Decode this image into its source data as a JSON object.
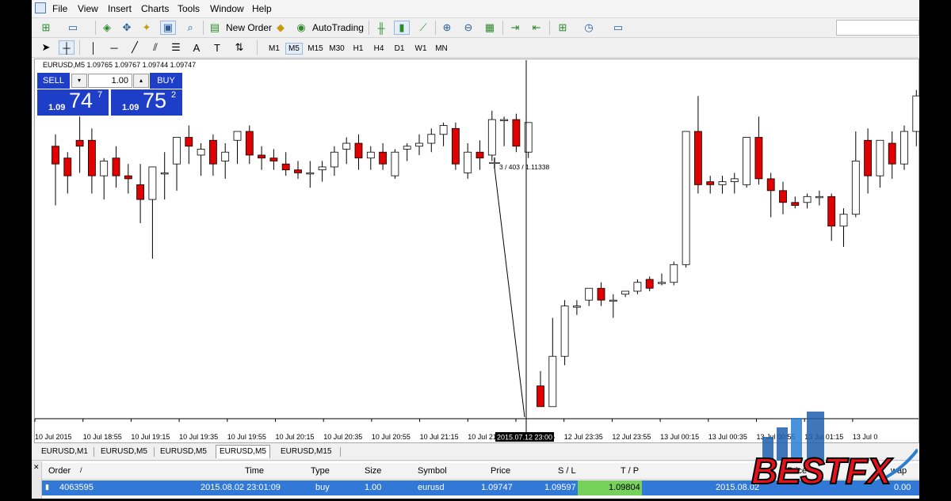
{
  "menu": [
    "File",
    "View",
    "Insert",
    "Charts",
    "Tools",
    "Window",
    "Help"
  ],
  "toolbar": {
    "new_order": "New Order",
    "autotrading": "AutoTrading"
  },
  "timeframes": [
    "M1",
    "M5",
    "M15",
    "M30",
    "H1",
    "H4",
    "D1",
    "W1",
    "MN"
  ],
  "active_timeframe": "M5",
  "chart_header": "EURUSD,M5  1.09765 1.09767 1.09744 1.09747",
  "one_click": {
    "sell_label": "SELL",
    "buy_label": "BUY",
    "lot": "1.00",
    "sell": {
      "small": "1.09",
      "big": "74",
      "pip": "7"
    },
    "buy": {
      "small": "1.09",
      "big": "75",
      "pip": "2"
    }
  },
  "crosshair_label": "3 / 403 / 1.11338",
  "crosshair_time": "2015.07.12 23:00",
  "chart_data": {
    "type": "candlestick",
    "symbol": "EURUSD",
    "timeframe": "M5",
    "x_tick_labels": [
      "10 Jul 2015",
      "10 Jul 18:55",
      "10 Jul 19:15",
      "10 Jul 19:35",
      "10 Jul 19:55",
      "10 Jul 20:15",
      "10 Jul 20:35",
      "10 Jul 20:55",
      "10 Jul 21:15",
      "10 Jul 21:",
      "12 Jul 23:15",
      "12 Jul 23:35",
      "12 Jul 23:55",
      "13 Jul 00:15",
      "13 Jul 00:35",
      "13 Jul 00:55",
      "13 Jul 01:15",
      "13 Jul 0"
    ],
    "bullish_color": "#ffffff",
    "bearish_color": "#e00000",
    "candles": [
      {
        "o": 0.66,
        "h": 0.7,
        "l": 0.46,
        "c": 0.6
      },
      {
        "o": 0.62,
        "h": 0.64,
        "l": 0.5,
        "c": 0.56
      },
      {
        "o": 0.68,
        "h": 0.76,
        "l": 0.57,
        "c": 0.66
      },
      {
        "o": 0.68,
        "h": 0.72,
        "l": 0.5,
        "c": 0.56
      },
      {
        "o": 0.56,
        "h": 0.62,
        "l": 0.48,
        "c": 0.61
      },
      {
        "o": 0.62,
        "h": 0.66,
        "l": 0.52,
        "c": 0.56
      },
      {
        "o": 0.56,
        "h": 0.6,
        "l": 0.5,
        "c": 0.55
      },
      {
        "o": 0.53,
        "h": 0.6,
        "l": 0.4,
        "c": 0.48
      },
      {
        "o": 0.48,
        "h": 0.59,
        "l": 0.28,
        "c": 0.59
      },
      {
        "o": 0.57,
        "h": 0.64,
        "l": 0.48,
        "c": 0.57
      },
      {
        "o": 0.6,
        "h": 0.66,
        "l": 0.51,
        "c": 0.69
      },
      {
        "o": 0.69,
        "h": 0.73,
        "l": 0.6,
        "c": 0.66
      },
      {
        "o": 0.63,
        "h": 0.67,
        "l": 0.56,
        "c": 0.65
      },
      {
        "o": 0.68,
        "h": 0.7,
        "l": 0.56,
        "c": 0.6
      },
      {
        "o": 0.61,
        "h": 0.67,
        "l": 0.55,
        "c": 0.64
      },
      {
        "o": 0.68,
        "h": 0.7,
        "l": 0.6,
        "c": 0.71
      },
      {
        "o": 0.71,
        "h": 0.73,
        "l": 0.6,
        "c": 0.63
      },
      {
        "o": 0.63,
        "h": 0.66,
        "l": 0.58,
        "c": 0.62
      },
      {
        "o": 0.62,
        "h": 0.65,
        "l": 0.58,
        "c": 0.61
      },
      {
        "o": 0.6,
        "h": 0.64,
        "l": 0.56,
        "c": 0.58
      },
      {
        "o": 0.58,
        "h": 0.61,
        "l": 0.55,
        "c": 0.57
      },
      {
        "o": 0.57,
        "h": 0.61,
        "l": 0.52,
        "c": 0.57
      },
      {
        "o": 0.58,
        "h": 0.61,
        "l": 0.54,
        "c": 0.59
      },
      {
        "o": 0.59,
        "h": 0.66,
        "l": 0.56,
        "c": 0.64
      },
      {
        "o": 0.65,
        "h": 0.69,
        "l": 0.6,
        "c": 0.67
      },
      {
        "o": 0.67,
        "h": 0.7,
        "l": 0.58,
        "c": 0.62
      },
      {
        "o": 0.62,
        "h": 0.66,
        "l": 0.58,
        "c": 0.64
      },
      {
        "o": 0.64,
        "h": 0.67,
        "l": 0.58,
        "c": 0.6
      },
      {
        "o": 0.56,
        "h": 0.65,
        "l": 0.55,
        "c": 0.64
      },
      {
        "o": 0.65,
        "h": 0.67,
        "l": 0.61,
        "c": 0.66
      },
      {
        "o": 0.66,
        "h": 0.7,
        "l": 0.63,
        "c": 0.67
      },
      {
        "o": 0.67,
        "h": 0.72,
        "l": 0.64,
        "c": 0.7
      },
      {
        "o": 0.7,
        "h": 0.74,
        "l": 0.66,
        "c": 0.73
      },
      {
        "o": 0.72,
        "h": 0.74,
        "l": 0.58,
        "c": 0.6
      },
      {
        "o": 0.57,
        "h": 0.67,
        "l": 0.55,
        "c": 0.64
      },
      {
        "o": 0.64,
        "h": 0.68,
        "l": 0.58,
        "c": 0.62
      },
      {
        "o": 0.63,
        "h": 0.78,
        "l": 0.61,
        "c": 0.75
      },
      {
        "o": 0.75,
        "h": 0.76,
        "l": 0.66,
        "c": 0.75
      },
      {
        "o": 0.75,
        "h": 0.77,
        "l": 0.64,
        "c": 0.66
      },
      {
        "o": 0.64,
        "h": 0.74,
        "l": 0.62,
        "c": 0.74
      },
      {
        "o": -0.15,
        "h": -0.1,
        "l": -0.22,
        "c": -0.22
      },
      {
        "o": -0.22,
        "h": 0.08,
        "l": -0.22,
        "c": -0.05
      },
      {
        "o": -0.05,
        "h": 0.14,
        "l": -0.08,
        "c": 0.12
      },
      {
        "o": 0.12,
        "h": 0.14,
        "l": 0.09,
        "c": 0.12
      },
      {
        "o": 0.14,
        "h": 0.18,
        "l": 0.12,
        "c": 0.18
      },
      {
        "o": 0.18,
        "h": 0.2,
        "l": 0.12,
        "c": 0.14
      },
      {
        "o": 0.14,
        "h": 0.16,
        "l": 0.08,
        "c": 0.14
      },
      {
        "o": 0.16,
        "h": 0.17,
        "l": 0.15,
        "c": 0.17
      },
      {
        "o": 0.17,
        "h": 0.21,
        "l": 0.16,
        "c": 0.2
      },
      {
        "o": 0.21,
        "h": 0.22,
        "l": 0.17,
        "c": 0.18
      },
      {
        "o": 0.2,
        "h": 0.23,
        "l": 0.19,
        "c": 0.2
      },
      {
        "o": 0.2,
        "h": 0.27,
        "l": 0.19,
        "c": 0.26
      },
      {
        "o": 0.26,
        "h": 0.33,
        "l": 0.25,
        "c": 0.71
      },
      {
        "o": 0.71,
        "h": 0.83,
        "l": 0.5,
        "c": 0.53
      },
      {
        "o": 0.54,
        "h": 0.56,
        "l": 0.5,
        "c": 0.53
      },
      {
        "o": 0.53,
        "h": 0.56,
        "l": 0.5,
        "c": 0.54
      },
      {
        "o": 0.54,
        "h": 0.57,
        "l": 0.5,
        "c": 0.55
      },
      {
        "o": 0.53,
        "h": 0.68,
        "l": 0.52,
        "c": 0.69
      },
      {
        "o": 0.69,
        "h": 0.76,
        "l": 0.53,
        "c": 0.55
      },
      {
        "o": 0.55,
        "h": 0.57,
        "l": 0.42,
        "c": 0.51
      },
      {
        "o": 0.51,
        "h": 0.54,
        "l": 0.43,
        "c": 0.47
      },
      {
        "o": 0.47,
        "h": 0.49,
        "l": 0.45,
        "c": 0.46
      },
      {
        "o": 0.47,
        "h": 0.5,
        "l": 0.45,
        "c": 0.49
      },
      {
        "o": 0.49,
        "h": 0.51,
        "l": 0.46,
        "c": 0.49
      },
      {
        "o": 0.49,
        "h": 0.5,
        "l": 0.34,
        "c": 0.39
      },
      {
        "o": 0.39,
        "h": 0.45,
        "l": 0.32,
        "c": 0.43
      },
      {
        "o": 0.43,
        "h": 0.71,
        "l": 0.42,
        "c": 0.61
      },
      {
        "o": 0.68,
        "h": 0.72,
        "l": 0.5,
        "c": 0.56
      },
      {
        "o": 0.56,
        "h": 0.68,
        "l": 0.52,
        "c": 0.68
      },
      {
        "o": 0.67,
        "h": 0.71,
        "l": 0.55,
        "c": 0.6
      },
      {
        "o": 0.6,
        "h": 0.73,
        "l": 0.58,
        "c": 0.71
      },
      {
        "o": 0.71,
        "h": 0.85,
        "l": 0.66,
        "c": 0.83
      },
      {
        "o": 0.83,
        "h": 0.86,
        "l": 0.75,
        "c": 0.8
      },
      {
        "o": 0.8,
        "h": 0.83,
        "l": 0.62,
        "c": 0.65
      },
      {
        "o": 0.65,
        "h": 0.7,
        "l": 0.58,
        "c": 0.62
      }
    ]
  },
  "tabs": [
    "EURUSD,M1",
    "EURUSD,M5",
    "EURUSD,M5",
    "EURUSD,M5",
    "EURUSD,M15"
  ],
  "active_tab": 3,
  "terminal": {
    "headers": {
      "order": "Order",
      "sort": "/",
      "time": "Time",
      "type": "Type",
      "size": "Size",
      "symbol": "Symbol",
      "price": "Price",
      "sl": "S / L",
      "tp": "T / P",
      "price2": "Price",
      "swap": "wap"
    },
    "row": {
      "order": "4063595",
      "time": "2015.08.02 23:01:09",
      "type": "buy",
      "size": "1.00",
      "symbol": "eurusd",
      "price": "1.09747",
      "sl": "1.09597",
      "tp": "1.09804",
      "time2": "2015.08.02",
      "swap": "0.00"
    }
  },
  "watermark": "BESTFX",
  "colors": {
    "one_click_blue": "#1e3ec8",
    "selected_row": "#3278d6",
    "tp_green": "#77d25c",
    "bear_candle": "#e00000"
  }
}
